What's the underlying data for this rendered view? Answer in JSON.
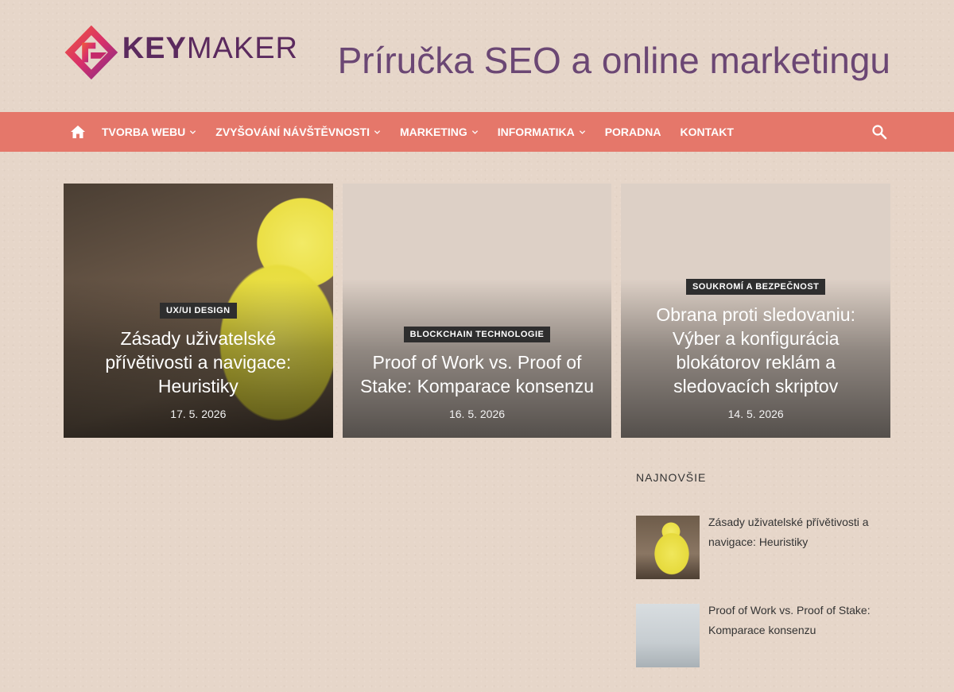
{
  "header": {
    "logo_key": "KEY",
    "logo_maker": "MAKER",
    "site_title": "Príručka SEO a online marketingu"
  },
  "nav": {
    "items": [
      {
        "label": "TVORBA WEBU",
        "has_dropdown": true
      },
      {
        "label": "ZVYŠOVÁNÍ NÁVŠTĚVNOSTI",
        "has_dropdown": true
      },
      {
        "label": "MARKETING",
        "has_dropdown": true
      },
      {
        "label": "INFORMATIKA",
        "has_dropdown": true
      },
      {
        "label": "PORADNA",
        "has_dropdown": false
      },
      {
        "label": "KONTAKT",
        "has_dropdown": false
      }
    ],
    "home_icon": "home-icon",
    "search_icon": "search-icon"
  },
  "featured": [
    {
      "category": "UX/UI DESIGN",
      "title": "Zásady uživatelské přívětivosti a navigace: Heuristiky",
      "date": "17. 5. 2026"
    },
    {
      "category": "BLOCKCHAIN TECHNOLOGIE",
      "title": "Proof of Work vs. Proof of Stake: Komparace konsenzu",
      "date": "16. 5. 2026"
    },
    {
      "category": "SOUKROMÍ A BEZPEČNOST",
      "title": "Obrana proti sledovaniu: Výber a konfigurácia blokátorov reklám a sledovacích skriptov",
      "date": "14. 5. 2026"
    }
  ],
  "sidebar": {
    "title": "NAJNOVŠIE",
    "posts": [
      {
        "title": "Zásady uživatelské přívětivosti a navigace: Heuristiky"
      },
      {
        "title": "Proof of Work vs. Proof of Stake: Komparace konsenzu"
      }
    ]
  },
  "colors": {
    "nav_bg": "#e5776a",
    "title_color": "#6b4774",
    "badge_bg": "#2e2e2e"
  }
}
